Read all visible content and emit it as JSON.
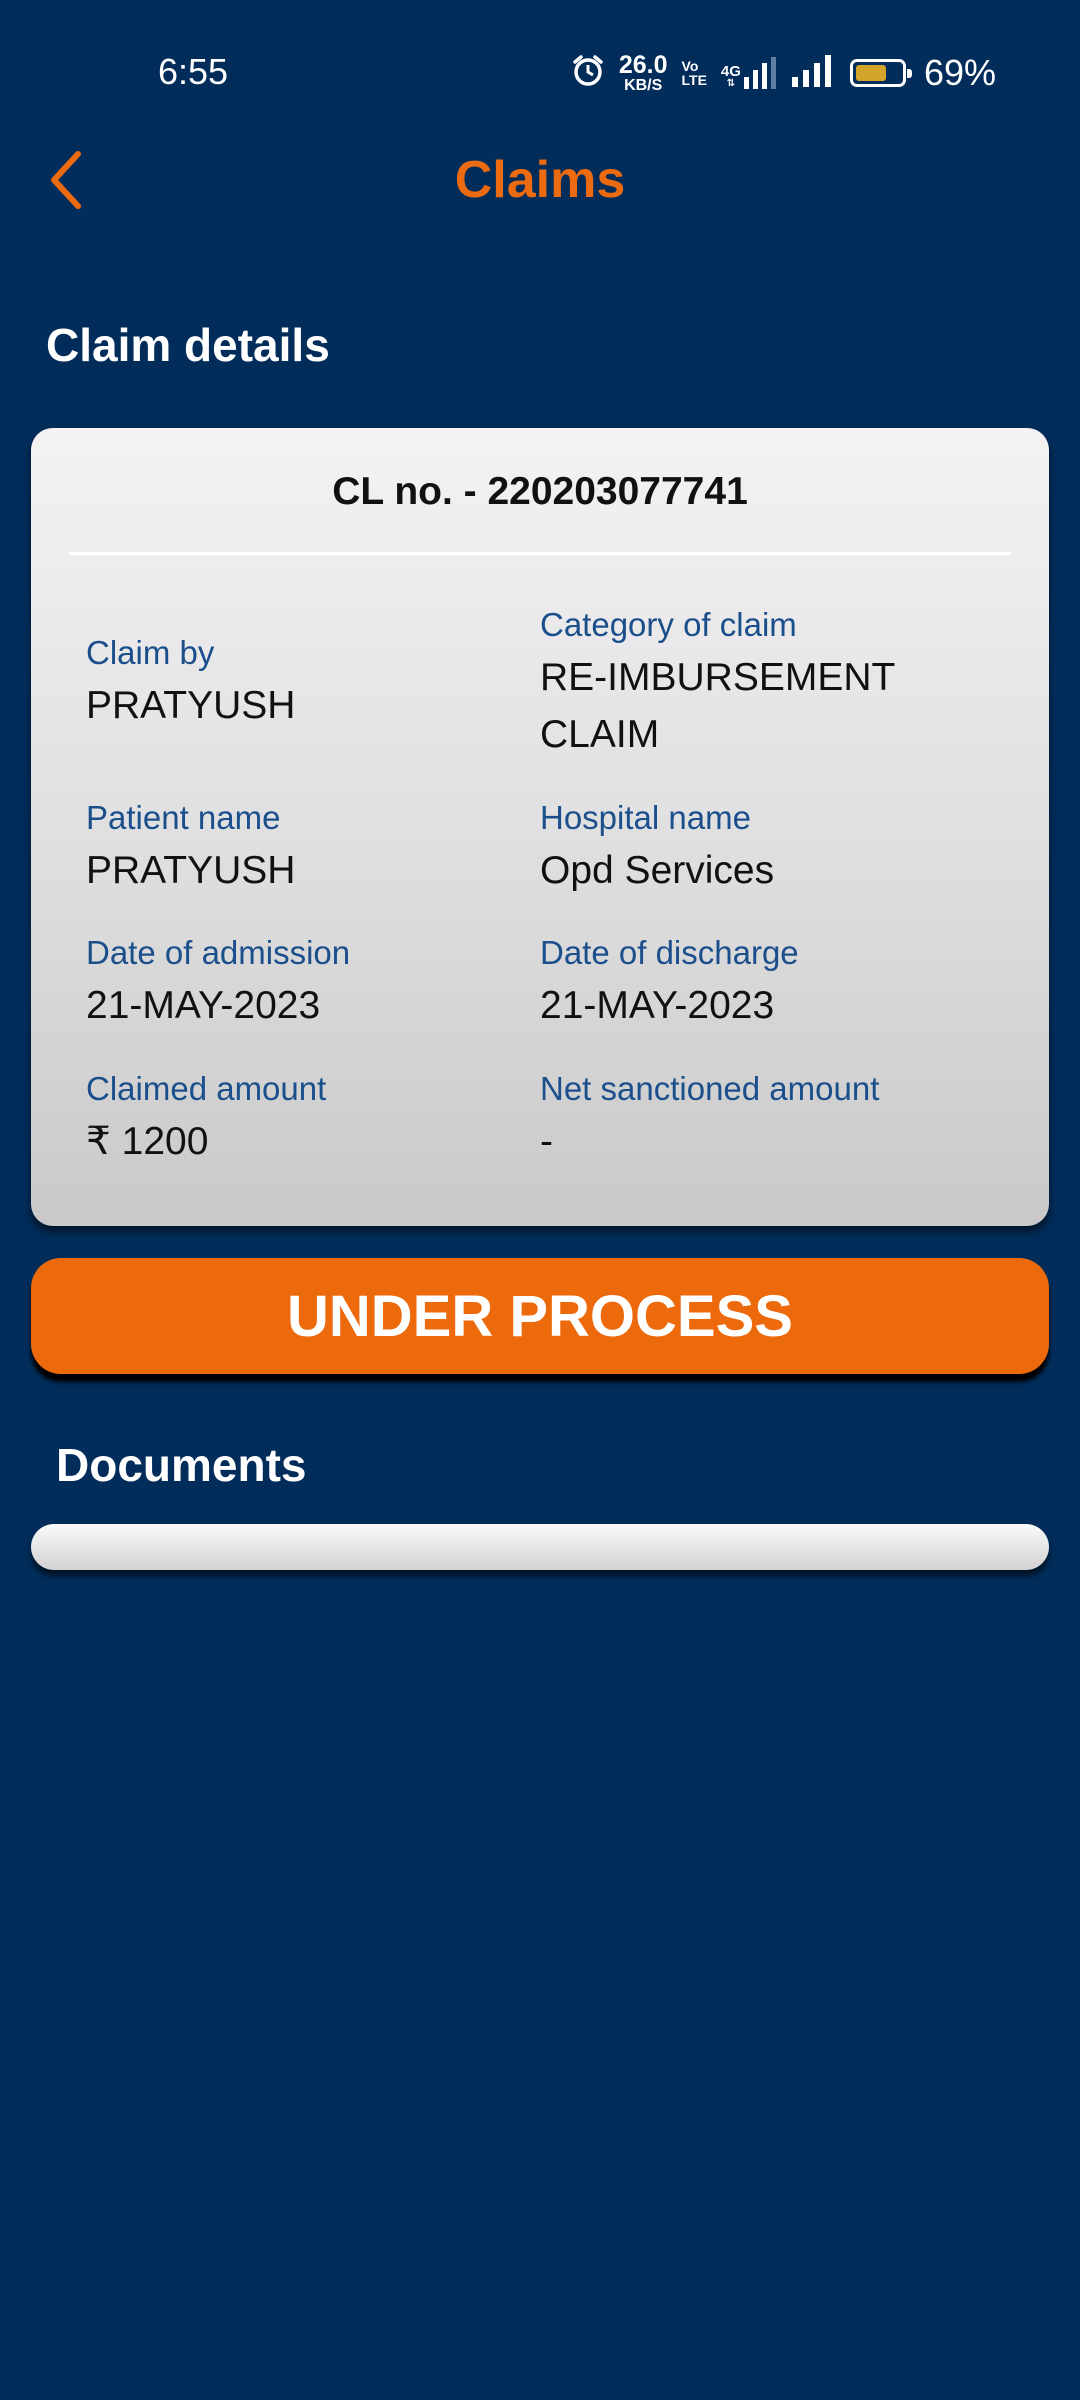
{
  "status_bar": {
    "time": "6:55",
    "net_speed_value": "26.0",
    "net_speed_unit": "KB/S",
    "volte_top": "Vo",
    "volte_bottom": "LTE",
    "network_type": "4G",
    "battery_percent": "69%",
    "battery_level": 0.69,
    "battery_color": "#d4a52a",
    "icons": [
      "alarm-icon",
      "signal-4g-icon",
      "signal-icon",
      "battery-icon"
    ]
  },
  "header": {
    "title": "Claims",
    "back_icon": "chevron-left-icon",
    "accent_color": "#ec6a10"
  },
  "section": {
    "claim_details_title": "Claim details",
    "documents_title": "Documents"
  },
  "claim": {
    "number_label": "CL no. - 220203077741",
    "fields": [
      {
        "label": "Claim by",
        "value": "PRATYUSH"
      },
      {
        "label": "Category of claim",
        "value": "RE-IMBURSEMENT CLAIM"
      },
      {
        "label": "Patient name",
        "value": "PRATYUSH"
      },
      {
        "label": "Hospital name",
        "value": "Opd Services"
      },
      {
        "label": "Date of admission",
        "value": "21-MAY-2023"
      },
      {
        "label": "Date of discharge",
        "value": "21-MAY-2023"
      },
      {
        "label": "Claimed amount",
        "value": "₹ 1200"
      },
      {
        "label": "Net sanctioned amount",
        "value": "-"
      }
    ]
  },
  "status": {
    "label": "UNDER PROCESS",
    "color": "#ec6a0c"
  },
  "colors": {
    "background": "#022d5a",
    "label": "#1a4f8c"
  }
}
